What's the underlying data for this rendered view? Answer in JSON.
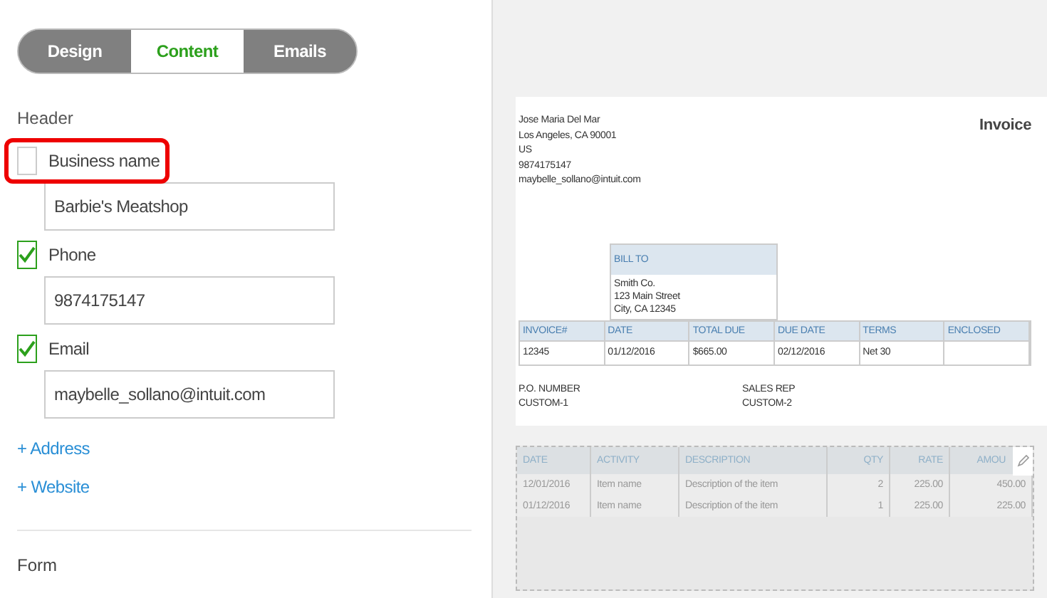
{
  "tabs": [
    {
      "label": "Design",
      "selected": false
    },
    {
      "label": "Content",
      "selected": true
    },
    {
      "label": "Emails",
      "selected": false
    }
  ],
  "header": {
    "title": "Header",
    "fields": [
      {
        "label": "Business name",
        "checked": false,
        "highlighted": true,
        "value": "Barbie's Meatshop"
      },
      {
        "label": "Phone",
        "checked": true,
        "highlighted": false,
        "value": "9874175147"
      },
      {
        "label": "Email",
        "checked": true,
        "highlighted": false,
        "value": "maybelle_sollano@intuit.com"
      }
    ],
    "links": [
      "+ Address",
      "+ Website"
    ]
  },
  "form_title": "Form",
  "invoice": {
    "sender": [
      "Jose Maria Del Mar",
      "Los Angeles, CA 90001",
      "US",
      "9874175147",
      "maybelle_sollano@intuit.com"
    ],
    "title": "Invoice",
    "bill_to": {
      "label": "BILL TO",
      "lines": [
        "Smith Co.",
        "123 Main Street",
        "City, CA 12345"
      ]
    },
    "summary": {
      "columns": [
        "INVOICE#",
        "DATE",
        "TOTAL DUE",
        "DUE DATE",
        "TERMS",
        "ENCLOSED"
      ],
      "values": [
        "12345",
        "01/12/2016",
        "$665.00",
        "02/12/2016",
        "Net 30"
      ]
    },
    "extras": [
      {
        "label": "P.O. NUMBER",
        "value": "CUSTOM-1"
      },
      {
        "label": "SALES REP",
        "value": "CUSTOM-2"
      }
    ],
    "items": {
      "columns": [
        "DATE",
        "ACTIVITY",
        "DESCRIPTION",
        "QTY",
        "RATE",
        "AMOU"
      ],
      "rows": [
        [
          "12/01/2016",
          "Item name",
          "Description of the item",
          "2",
          "225.00",
          "450.00"
        ],
        [
          "01/12/2016",
          "Item name",
          "Description of the item",
          "1",
          "225.00",
          "225.00"
        ]
      ]
    }
  }
}
